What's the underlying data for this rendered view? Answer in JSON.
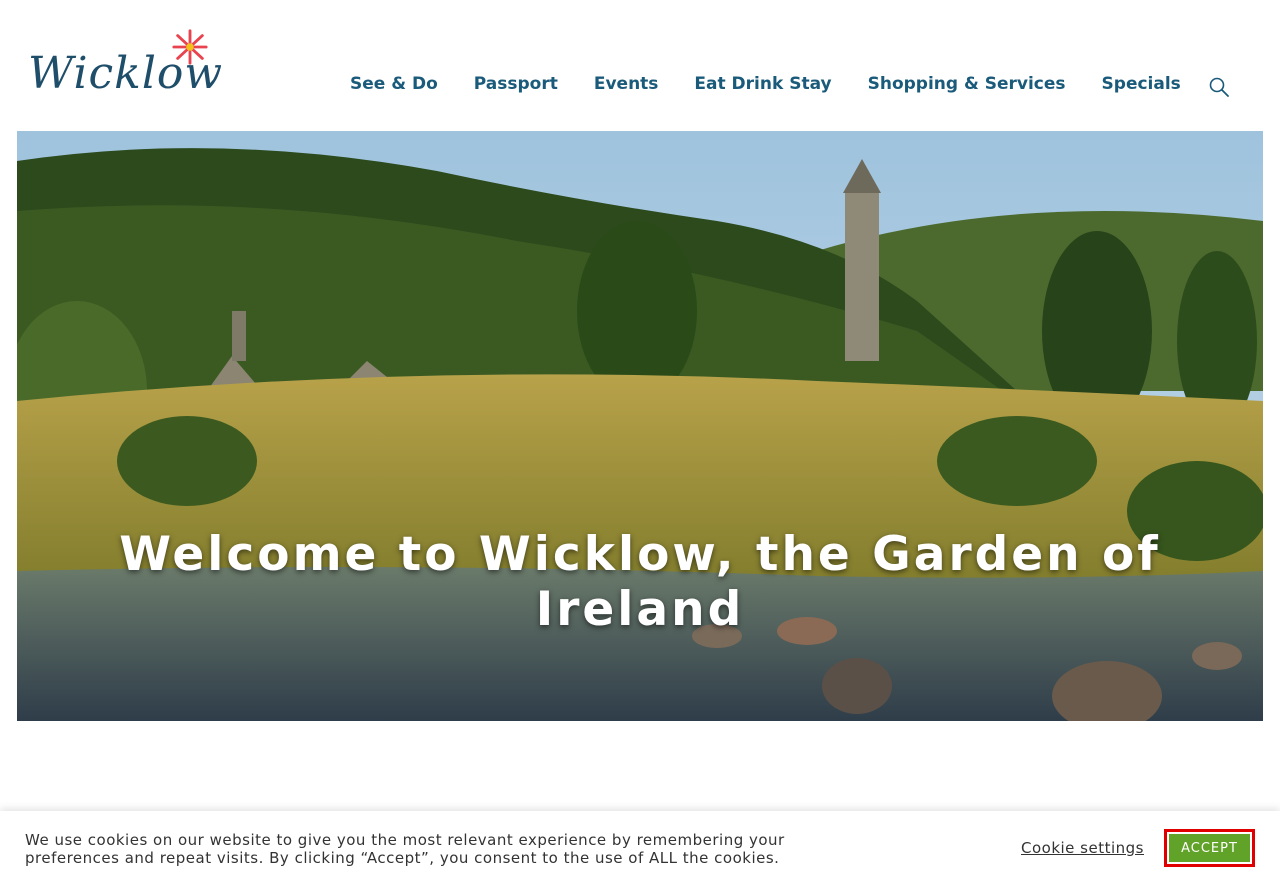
{
  "header": {
    "logo_text": "Wicklow",
    "nav": [
      {
        "label": "See & Do"
      },
      {
        "label": "Passport"
      },
      {
        "label": "Events"
      },
      {
        "label": "Eat Drink Stay"
      },
      {
        "label": "Shopping & Services"
      },
      {
        "label": "Specials"
      }
    ],
    "search_icon": "search-icon"
  },
  "hero": {
    "title": "Welcome to Wicklow, the Garden of Ireland"
  },
  "cookie_banner": {
    "text": "We use cookies on our website to give you the most relevant experience by remembering your preferences and repeat visits. By clicking “Accept”, you consent to the use of ALL the cookies.",
    "settings_label": "Cookie settings",
    "accept_label": "ACCEPT"
  },
  "colors": {
    "nav_text": "#1a5a7a",
    "logo": "#1f4e6b",
    "flower": "#e8434e",
    "accept_bg": "#61a229",
    "highlight_border": "#e00000"
  }
}
